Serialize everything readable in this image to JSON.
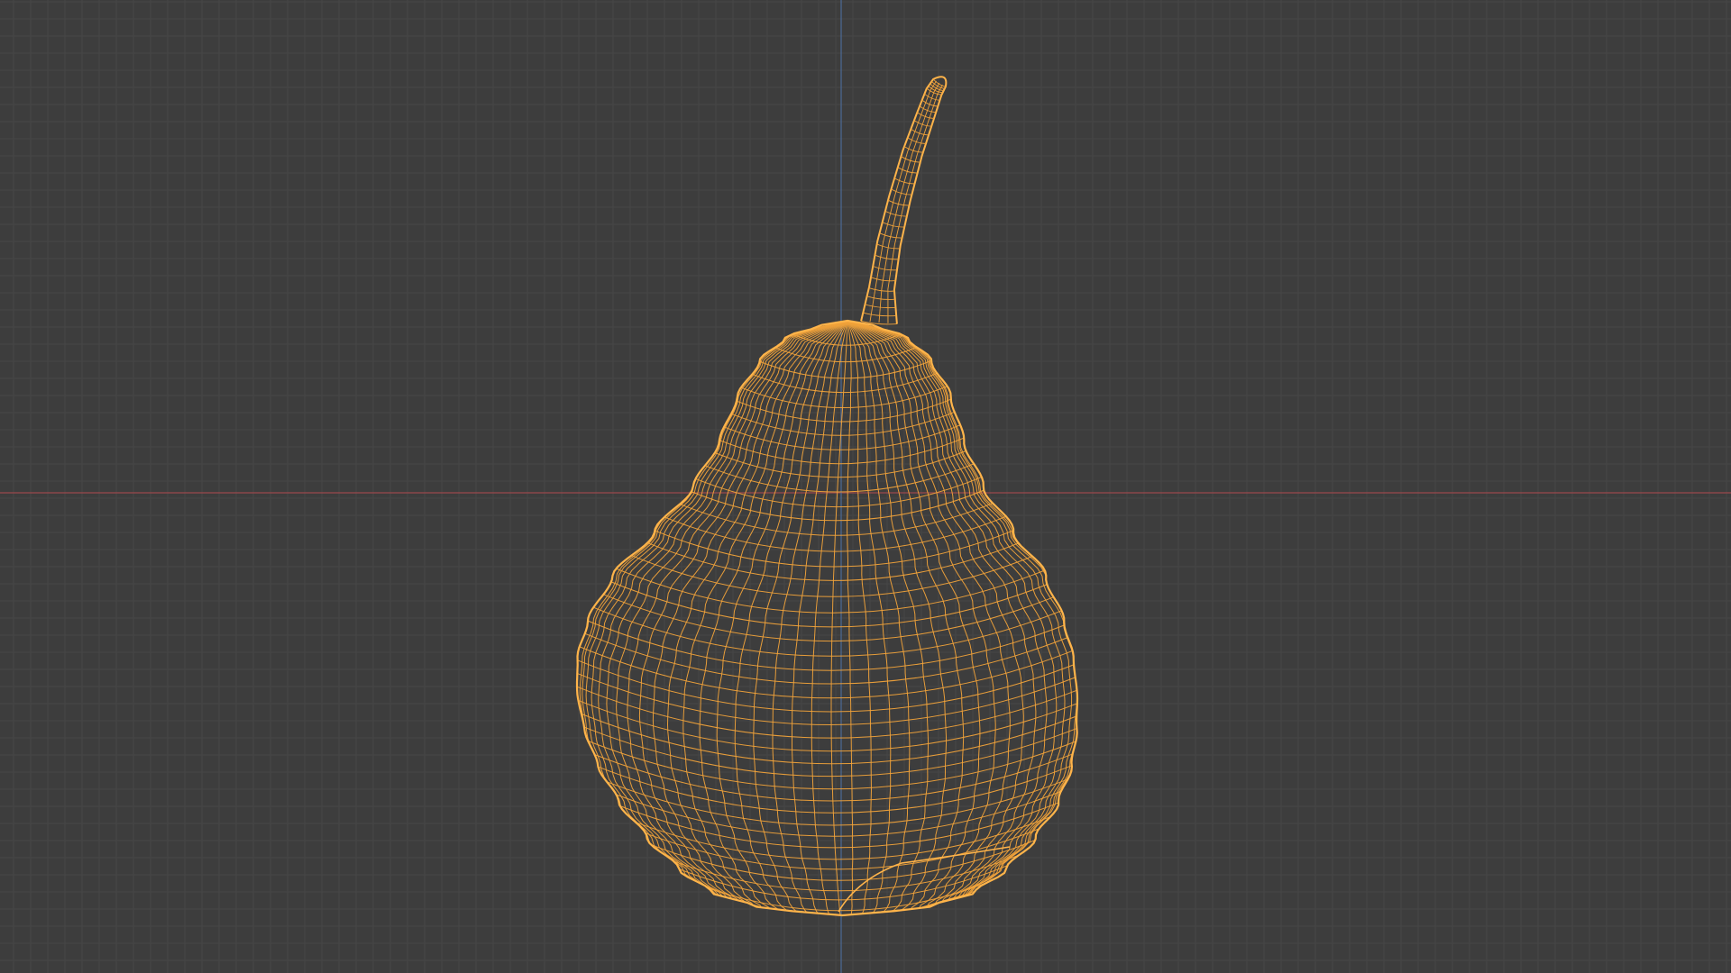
{
  "viewport": {
    "mode": "wireframe",
    "object": "pear",
    "background_color": "#3d3d3d",
    "grid_minor_color": "#474747",
    "grid_major_color": "#4b4b4b",
    "x_axis_color": "#9a4a4d",
    "y_axis_color": "#4d6a96",
    "wire_color": "#f0a23a",
    "outline_color": "#ffb44a"
  }
}
